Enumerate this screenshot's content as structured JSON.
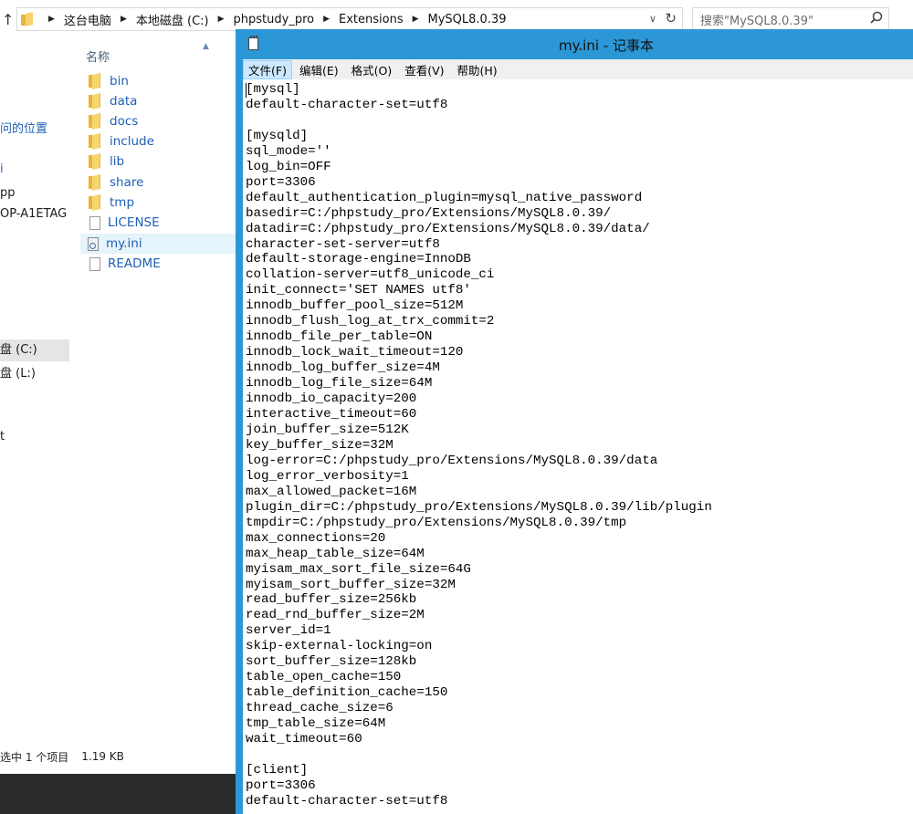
{
  "explorer": {
    "breadcrumb": [
      "这台电脑",
      "本地磁盘 (C:)",
      "phpstudy_pro",
      "Extensions",
      "MySQL8.0.39"
    ],
    "search_placeholder": "搜索\"MySQL8.0.39\"",
    "nav": {
      "quick_access": "问的位置",
      "item_i": "i",
      "item_pp": "pp",
      "item_pc": "OP-A1ETAG",
      "disk_c": "盘 (C:)",
      "disk_l": "盘 (L:)",
      "item_t": "t"
    },
    "column_name": "名称",
    "files": [
      {
        "name": "bin",
        "type": "folder"
      },
      {
        "name": "data",
        "type": "folder"
      },
      {
        "name": "docs",
        "type": "folder"
      },
      {
        "name": "include",
        "type": "folder"
      },
      {
        "name": "lib",
        "type": "folder"
      },
      {
        "name": "share",
        "type": "folder"
      },
      {
        "name": "tmp",
        "type": "folder"
      },
      {
        "name": "LICENSE",
        "type": "file"
      },
      {
        "name": "my.ini",
        "type": "ini",
        "selected": true
      },
      {
        "name": "README",
        "type": "file"
      }
    ],
    "status_count": "选中 1 个项目",
    "status_size": "1.19 KB"
  },
  "notepad": {
    "title": "my.ini - 记事本",
    "menus": [
      "文件(F)",
      "编辑(E)",
      "格式(O)",
      "查看(V)",
      "帮助(H)"
    ],
    "content": "[mysql]\ndefault-character-set=utf8\n\n[mysqld]\nsql_mode=''\nlog_bin=OFF\nport=3306\ndefault_authentication_plugin=mysql_native_password\nbasedir=C:/phpstudy_pro/Extensions/MySQL8.0.39/\ndatadir=C:/phpstudy_pro/Extensions/MySQL8.0.39/data/\ncharacter-set-server=utf8\ndefault-storage-engine=InnoDB\ncollation-server=utf8_unicode_ci\ninit_connect='SET NAMES utf8'\ninnodb_buffer_pool_size=512M\ninnodb_flush_log_at_trx_commit=2\ninnodb_file_per_table=ON\ninnodb_lock_wait_timeout=120\ninnodb_log_buffer_size=4M\ninnodb_log_file_size=64M\ninnodb_io_capacity=200\ninteractive_timeout=60\njoin_buffer_size=512K\nkey_buffer_size=32M\nlog-error=C:/phpstudy_pro/Extensions/MySQL8.0.39/data\nlog_error_verbosity=1\nmax_allowed_packet=16M\nplugin_dir=C:/phpstudy_pro/Extensions/MySQL8.0.39/lib/plugin\ntmpdir=C:/phpstudy_pro/Extensions/MySQL8.0.39/tmp\nmax_connections=20\nmax_heap_table_size=64M\nmyisam_max_sort_file_size=64G\nmyisam_sort_buffer_size=32M\nread_buffer_size=256kb\nread_rnd_buffer_size=2M\nserver_id=1\nskip-external-locking=on\nsort_buffer_size=128kb\ntable_open_cache=150\ntable_definition_cache=150\nthread_cache_size=6\ntmp_table_size=64M\nwait_timeout=60\n\n[client]\nport=3306\ndefault-character-set=utf8"
  }
}
